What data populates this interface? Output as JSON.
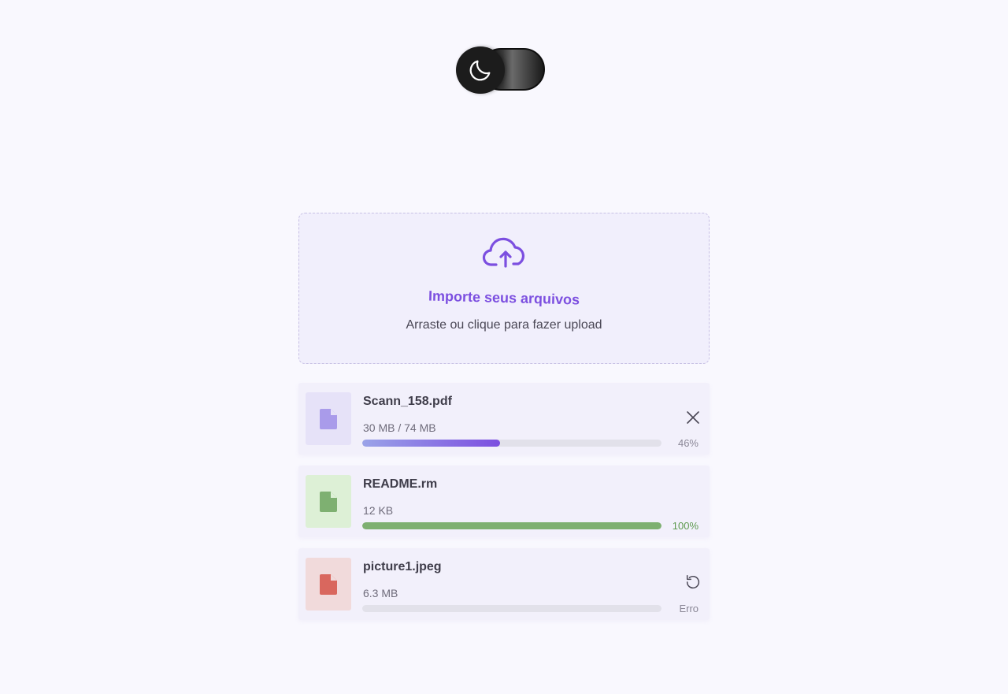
{
  "theme_toggle": {
    "icon": "moon-icon",
    "state": "dark"
  },
  "upload": {
    "icon": "cloud-upload-icon",
    "title": "Importe seus arquivos",
    "subtitle": "Arraste ou clique para fazer upload"
  },
  "files": [
    {
      "name": "Scann_158.pdf",
      "size": "30 MB / 74 MB",
      "progress": 0.46,
      "progress_label": "46%",
      "status": "uploading",
      "action_icon": "close-icon",
      "color": "#a99bea",
      "thumb_bg": "#e6e2f8"
    },
    {
      "name": "README.rm",
      "size": "12 KB",
      "progress": 1.0,
      "progress_label": "100%",
      "status": "complete",
      "action_icon": null,
      "color": "#7eb071",
      "thumb_bg": "#ddf0d6"
    },
    {
      "name": "picture1.jpeg",
      "size": "6.3 MB",
      "progress": 0,
      "progress_label": "Erro",
      "status": "error",
      "action_icon": "retry-icon",
      "color": "#d9675e",
      "thumb_bg": "#f1dadb"
    }
  ],
  "colors": {
    "accent": "#7c4fe0",
    "success": "#7eb071",
    "error": "#d9675e",
    "background": "#f9f8fe"
  }
}
